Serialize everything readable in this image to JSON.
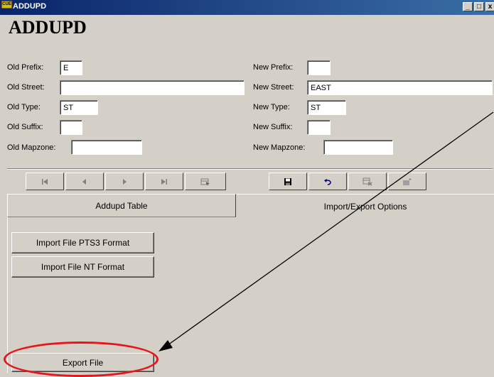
{
  "window": {
    "icon_text": "CUE",
    "title": "ADDUPD",
    "minimize_glyph": "_",
    "maximize_glyph": "□"
  },
  "heading": "ADDUPD",
  "old": {
    "prefix_label": "Old Prefix:",
    "prefix_value": "E",
    "street_label": "Old Street:",
    "street_value": "",
    "type_label": "Old Type:",
    "type_value": "ST",
    "suffix_label": "Old Suffix:",
    "suffix_value": "",
    "mapzone_label": "Old Mapzone:",
    "mapzone_value": ""
  },
  "new": {
    "prefix_label": "New Prefix:",
    "prefix_value": "",
    "street_label": "New Street:",
    "street_value": "EAST",
    "type_label": "New Type:",
    "type_value": "ST",
    "suffix_label": "New Suffix:",
    "suffix_value": "",
    "mapzone_label": "New Mapzone:",
    "mapzone_value": ""
  },
  "navigation_icons": [
    "first-record-icon",
    "previous-record-icon",
    "next-record-icon",
    "last-record-icon",
    "find-record-icon"
  ],
  "edit_icons": [
    "save-icon",
    "undo-icon",
    "delete-record-icon",
    "new-record-icon"
  ],
  "tabs": {
    "table": "Addupd Table",
    "import_export": "Import/Export Options"
  },
  "buttons": {
    "import_pts3": "Import File PTS3 Format",
    "import_nt": "Import File NT Format",
    "export": "Export File"
  },
  "annotation_color": "#e8141c"
}
